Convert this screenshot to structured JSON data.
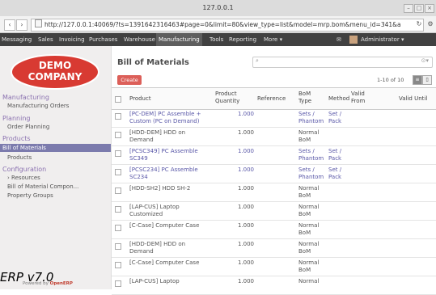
{
  "window": {
    "title": "127.0.0.1"
  },
  "address": {
    "url": "http://127.0.0.1:40069/?ts=1391642316463#page=0&limit=80&view_type=list&model=mrp.bom&menu_id=341&a"
  },
  "top_menu": {
    "items": [
      "Messaging",
      "Sales",
      "Invoicing",
      "Purchases",
      "Warehouse",
      "Manufacturing",
      "Tools",
      "Reporting",
      "More ▾"
    ],
    "active": "Manufacturing",
    "user": "Administrator ▾"
  },
  "logo": {
    "line1": "DEMO",
    "line2": "COMPANY"
  },
  "sidebar": {
    "sections": [
      {
        "title": "Manufacturing",
        "items": [
          "Manufacturing Orders"
        ]
      },
      {
        "title": "Planning",
        "items": [
          "Order Planning"
        ]
      },
      {
        "title": "Products",
        "items": [
          "Bill of Materials",
          "Products"
        ]
      },
      {
        "title": "Configuration",
        "items": [
          "› Resources",
          "Bill of Material Compon...",
          "Property Groups"
        ]
      }
    ],
    "selected": "Bill of Materials"
  },
  "main": {
    "title": "Bill of Materials",
    "create_label": "Create",
    "pager": "1-10 of 10"
  },
  "table": {
    "headers": {
      "product": "Product",
      "qty": "Product Quantity",
      "reference": "Reference",
      "bom_type": "BoM Type",
      "method": "Method",
      "valid_from": "Valid From",
      "valid_until": "Valid Until"
    },
    "rows": [
      {
        "product": [
          "[PC-DEM] PC Assemble +",
          "Custom (PC on Demand)"
        ],
        "qty": "1.000",
        "bom_type": [
          "Sets /",
          "Phantom"
        ],
        "method": [
          "Set /",
          "Pack"
        ],
        "link": true
      },
      {
        "product": [
          "[HDD-DEM] HDD on",
          "Demand"
        ],
        "qty": "1.000",
        "bom_type": [
          "Normal",
          "BoM"
        ],
        "method": [
          "",
          ""
        ],
        "link": false
      },
      {
        "product": [
          "[PCSC349] PC Assemble",
          "SC349"
        ],
        "qty": "1.000",
        "bom_type": [
          "Sets /",
          "Phantom"
        ],
        "method": [
          "Set /",
          "Pack"
        ],
        "link": true
      },
      {
        "product": [
          "[PCSC234] PC Assemble",
          "SC234"
        ],
        "qty": "1.000",
        "bom_type": [
          "Sets /",
          "Phantom"
        ],
        "method": [
          "Set /",
          "Pack"
        ],
        "link": true
      },
      {
        "product": [
          "[HDD-SH2] HDD SH-2",
          ""
        ],
        "qty": "1.000",
        "bom_type": [
          "Normal",
          "BoM"
        ],
        "method": [
          "",
          ""
        ],
        "link": false
      },
      {
        "product": [
          "[LAP-CUS] Laptop",
          "Customized"
        ],
        "qty": "1.000",
        "bom_type": [
          "Normal",
          "BoM"
        ],
        "method": [
          "",
          ""
        ],
        "link": false
      },
      {
        "product": [
          "[C-Case] Computer Case",
          ""
        ],
        "qty": "1.000",
        "bom_type": [
          "Normal",
          "BoM"
        ],
        "method": [
          "",
          ""
        ],
        "link": false
      },
      {
        "product": [
          "[HDD-DEM] HDD on",
          "Demand"
        ],
        "qty": "1.000",
        "bom_type": [
          "Normal",
          "BoM"
        ],
        "method": [
          "",
          ""
        ],
        "link": false
      },
      {
        "product": [
          "[C-Case] Computer Case",
          ""
        ],
        "qty": "1.000",
        "bom_type": [
          "Normal",
          "BoM"
        ],
        "method": [
          "",
          ""
        ],
        "link": false
      },
      {
        "product": [
          "[LAP-CUS] Laptop",
          ""
        ],
        "qty": "1.000",
        "bom_type": [
          "Normal",
          ""
        ],
        "method": [
          "",
          ""
        ],
        "link": false
      }
    ]
  },
  "footer": {
    "watermark": "ERP v7.0",
    "powered_prefix": "Powered by",
    "powered_brand": "OpenERP"
  }
}
